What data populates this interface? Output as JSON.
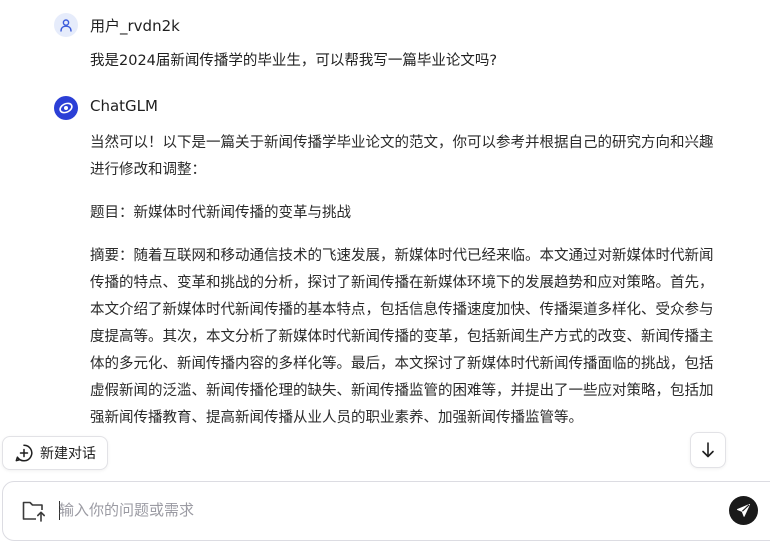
{
  "conversation": {
    "user": {
      "name": "用户_rvdn2k",
      "message": "我是2024届新闻传播学的毕业生，可以帮我写一篇毕业论文吗?"
    },
    "assistant": {
      "name": "ChatGLM",
      "paragraphs": [
        "当然可以！以下是一篇关于新闻传播学毕业论文的范文，你可以参考并根据自己的研究方向和兴趣进行修改和调整：",
        "题目：新媒体时代新闻传播的变革与挑战",
        "摘要：随着互联网和移动通信技术的飞速发展，新媒体时代已经来临。本文通过对新媒体时代新闻传播的特点、变革和挑战的分析，探讨了新闻传播在新媒体环境下的发展趋势和应对策略。首先，本文介绍了新媒体时代新闻传播的基本特点，包括信息传播速度加快、传播渠道多样化、受众参与度提高等。其次，本文分析了新媒体时代新闻传播的变革，包括新闻生产方式的改变、新闻传播主体的多元化、新闻传播内容的多样化等。最后，本文探讨了新媒体时代新闻传播面临的挑战，包括虚假新闻的泛滥、新闻传播伦理的缺失、新闻传播监管的困难等，并提出了一些应对策略，包括加强新闻传播教育、提高新闻传播从业人员的职业素养、加强新闻传播监管等。"
      ]
    }
  },
  "actions": {
    "new_chat_label": "新建对话"
  },
  "composer": {
    "placeholder": "输入你的问题或需求"
  },
  "colors": {
    "brand": "#2b3fd6",
    "send_button": "#1a1a1a"
  },
  "icons": {
    "user": "user-icon",
    "bot": "chatglm-logo-icon",
    "new_chat": "plus-chat-icon",
    "scroll": "arrow-down-icon",
    "upload": "folder-upload-icon",
    "send": "send-icon"
  }
}
